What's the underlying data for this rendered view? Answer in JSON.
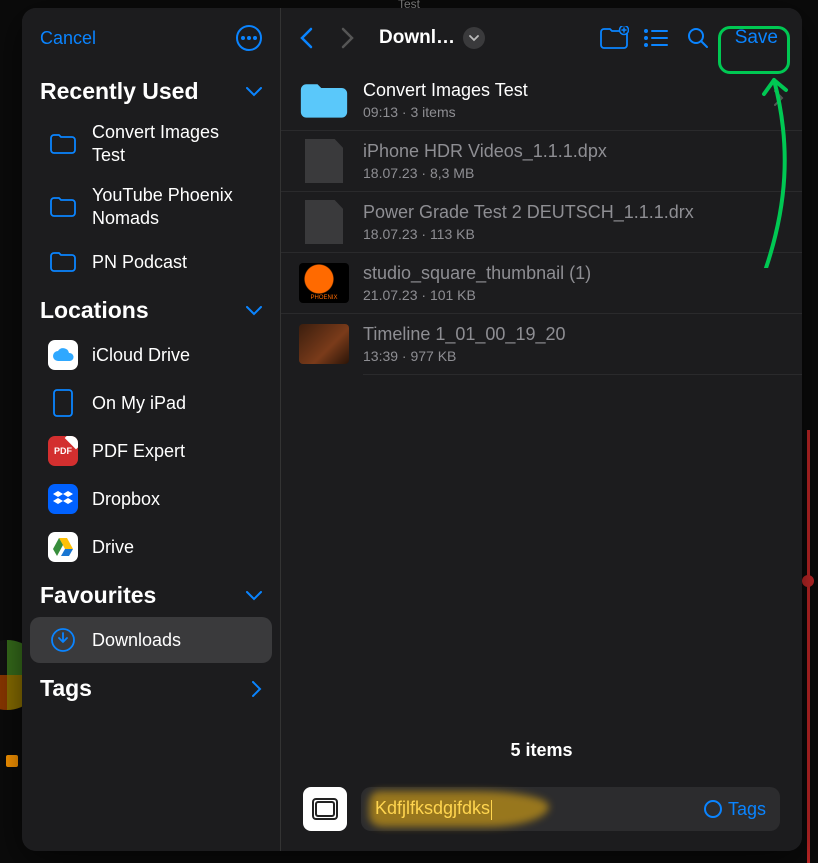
{
  "underlay": {
    "hint": "Test"
  },
  "toolbar": {
    "cancel": "Cancel",
    "breadcrumb": "Downl…",
    "save": "Save"
  },
  "sidebar": {
    "recent": {
      "title": "Recently Used",
      "items": [
        {
          "label": "Convert Images Test"
        },
        {
          "label": "YouTube Phoenix Nomads"
        },
        {
          "label": "PN Podcast"
        }
      ]
    },
    "locations": {
      "title": "Locations",
      "items": [
        {
          "label": "iCloud Drive"
        },
        {
          "label": "On My iPad"
        },
        {
          "label": "PDF Expert"
        },
        {
          "label": "Dropbox"
        },
        {
          "label": "Drive"
        }
      ]
    },
    "favourites": {
      "title": "Favourites",
      "items": [
        {
          "label": "Downloads"
        }
      ]
    },
    "tags": {
      "title": "Tags"
    }
  },
  "files": [
    {
      "title": "Convert Images Test",
      "sub": "09:13 · 3 items",
      "kind": "folder"
    },
    {
      "title": "iPhone HDR Videos_1.1.1.dpx",
      "sub": "18.07.23 · 8,3 MB",
      "kind": "file"
    },
    {
      "title": "Power Grade Test 2 DEUTSCH_1.1.1.drx",
      "sub": "18.07.23 · 113 KB",
      "kind": "file"
    },
    {
      "title": "studio_square_thumbnail (1)",
      "sub": "21.07.23 · 101 KB",
      "kind": "image1"
    },
    {
      "title": "Timeline 1_01_00_19_20",
      "sub": "13:39 · 977 KB",
      "kind": "image2"
    }
  ],
  "footer": {
    "count": "5 items"
  },
  "filename": {
    "value": "Kdfjlfksdgjfdks",
    "tags_label": "Tags"
  }
}
